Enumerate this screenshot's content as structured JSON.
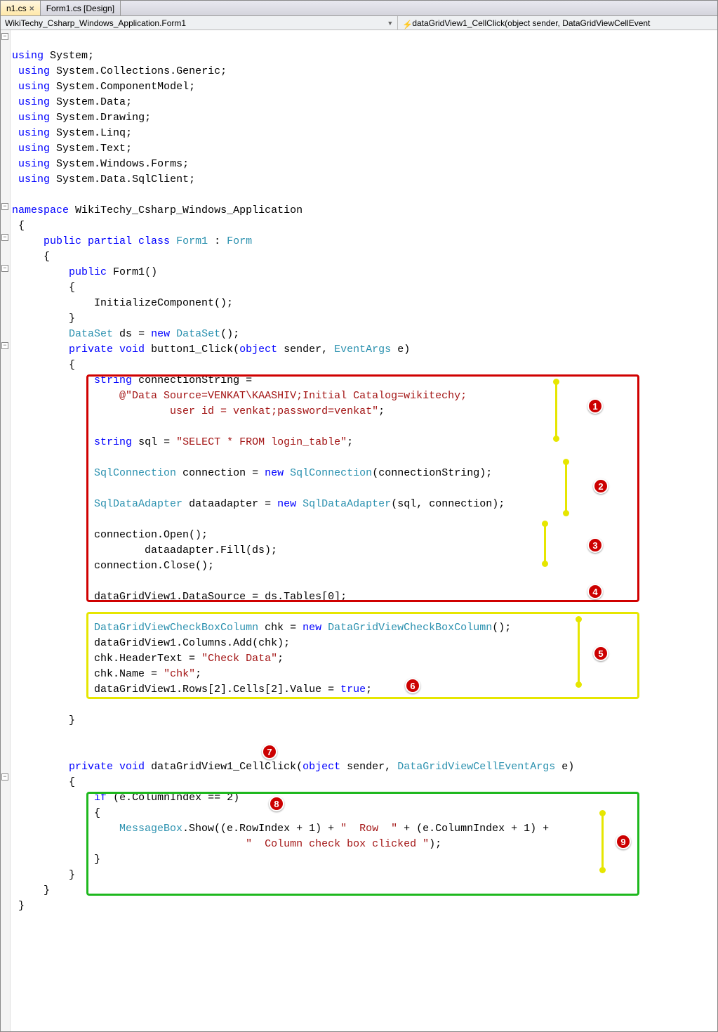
{
  "tabs": [
    {
      "label": "n1.cs",
      "active": true,
      "closable": true
    },
    {
      "label": "Form1.cs [Design]",
      "active": false,
      "closable": false
    }
  ],
  "breadcrumb": {
    "left": "WikiTechy_Csharp_Windows_Application.Form1",
    "right": "dataGridView1_CellClick(object sender, DataGridViewCellEvent"
  },
  "code": {
    "usings": [
      "System",
      "System.Collections.Generic",
      "System.ComponentModel",
      "System.Data",
      "System.Drawing",
      "System.Linq",
      "System.Text",
      "System.Windows.Forms",
      "System.Data.SqlClient"
    ],
    "namespace": "WikiTechy_Csharp_Windows_Application",
    "class_kw": "public partial class",
    "class_name": "Form1",
    "base_class": "Form",
    "ctor_kw": "public",
    "ctor_name": "Form1",
    "ctor_body": "InitializeComponent();",
    "dataset_decl_type": "DataSet",
    "dataset_decl_var": "ds",
    "dataset_decl_new": "DataSet",
    "btn_sig_mods": "private void",
    "btn_sig_name": "button1_Click",
    "btn_sig_obj": "object",
    "btn_sig_sender": "sender",
    "btn_sig_args": "EventArgs",
    "btn_sig_e": "e",
    "connstr_type": "string",
    "connstr_var": "connectionString =",
    "connstr_line1": "@\"Data Source=VENKAT\\KAASHIV;Initial Catalog=wikitechy;",
    "connstr_line2": "user id = venkat;password=venkat\"",
    "sql_type": "string",
    "sql_var": "sql =",
    "sql_val": "\"SELECT * FROM login_table\"",
    "conn_type": "SqlConnection",
    "conn_var": "connection =",
    "conn_new": "SqlConnection",
    "conn_arg": "(connectionString);",
    "adapter_type": "SqlDataAdapter",
    "adapter_var": "dataadapter =",
    "adapter_new": "SqlDataAdapter",
    "adapter_arg": "(sql, connection);",
    "open": "connection.Open();",
    "fill": "dataadapter.Fill(ds);",
    "close": "connection.Close();",
    "datasource": "dataGridView1.DataSource = ds.Tables[0];",
    "chk_type": "DataGridViewCheckBoxColumn",
    "chk_var": "chk =",
    "chk_new": "DataGridViewCheckBoxColumn",
    "chk_add": "dataGridView1.Columns.Add(chk);",
    "chk_header_lhs": "chk.HeaderText = ",
    "chk_header_val": "\"Check Data\"",
    "chk_name_lhs": "chk.Name = ",
    "chk_name_val": "\"chk\"",
    "chk_cell_lhs": "dataGridView1.Rows[2].Cells[2].Value = ",
    "chk_cell_true": "true",
    "cell_sig_mods": "private void",
    "cell_sig_name": "dataGridView1_CellClick",
    "cell_sig_obj": "object",
    "cell_sig_sender": "sender",
    "cell_sig_args": "DataGridViewCellEventArgs",
    "cell_sig_e": "e",
    "if_kw": "if",
    "if_cond": "(e.ColumnIndex == 2)",
    "msg_type": "MessageBox",
    "msg_show_pre": ".Show((e.RowIndex + 1) + ",
    "msg_str1": "\"  Row  \"",
    "msg_mid": " + (e.ColumnIndex + 1) +",
    "msg_str2": "\"  Column check box clicked \"",
    "msg_end": ");"
  },
  "annotations": {
    "badges": [
      "1",
      "2",
      "3",
      "4",
      "5",
      "6",
      "7",
      "8",
      "9"
    ]
  }
}
